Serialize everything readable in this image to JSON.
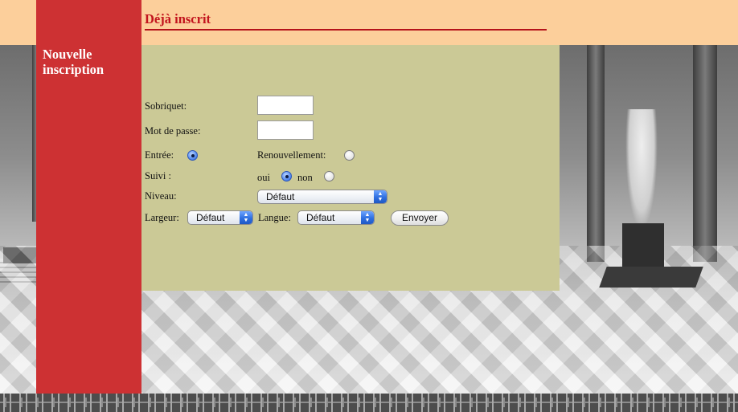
{
  "sidebar": {
    "new_registration": "Nouvelle inscription"
  },
  "header": {
    "title": "Déjà inscrit"
  },
  "form": {
    "nickname_label": "Sobriquet:",
    "nickname_value": "",
    "password_label": "Mot de passe:",
    "password_value": "",
    "entry_label": "Entrée:",
    "entry_selected": true,
    "renewal_label": "Renouvellement:",
    "renewal_selected": false,
    "follow_label": "Suivi :",
    "follow_yes_label": "oui",
    "follow_yes_selected": true,
    "follow_no_label": "non",
    "follow_no_selected": false,
    "level_label": "Niveau:",
    "level_value": "Défaut",
    "width_label": "Largeur:",
    "width_value": "Défaut",
    "language_label": "Langue:",
    "language_value": "Défaut",
    "submit_label": "Envoyer"
  },
  "colors": {
    "top_band": "#fccf9b",
    "sidebar": "#cd3133",
    "title": "#c2141d",
    "panel": "#cbc996"
  }
}
